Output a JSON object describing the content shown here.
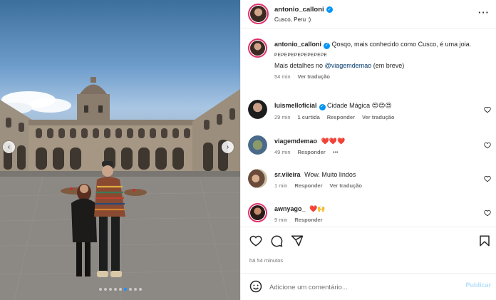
{
  "post": {
    "username": "antonio_calloni",
    "location": "Cusco, Peru :)",
    "more_icon": "more-horizontal-icon",
    "carousel": {
      "slide_count": 9,
      "active_slide": 6
    }
  },
  "caption": {
    "username": "antonio_calloni",
    "text": "Qosqo, mais conhecido como Cusco, é uma joia.",
    "caps_line": "PEPEPEPEPEPEPEPE",
    "details_prefix": "Mais detalhes no",
    "mention": "@viagemdemao",
    "details_suffix": "(em breve)",
    "time": "54 min",
    "translate": "Ver tradução"
  },
  "comments": [
    {
      "username": "luismelloficial",
      "verified": true,
      "text": "Cidade Mágica 😍😍😍",
      "time": "29 min",
      "likes": "1 curtida",
      "reply": "Responder",
      "translate": "Ver tradução"
    },
    {
      "username": "viagemdemao",
      "verified": false,
      "text": "❤️❤️❤️",
      "time": "49 min",
      "reply": "Responder",
      "more": "•••"
    },
    {
      "username": "sr.viieira",
      "verified": false,
      "text": "Wow. Muito lindos",
      "time": "1 min",
      "reply": "Responder",
      "translate": "Ver tradução"
    },
    {
      "username": "awnyago_",
      "verified": false,
      "text": "❤️🙌",
      "time": "9 min",
      "reply": "Responder"
    }
  ],
  "actions": {
    "like_icon": "heart-icon",
    "comment_icon": "comment-icon",
    "share_icon": "send-icon",
    "save_icon": "bookmark-icon",
    "timestamp": "há 54 minutos"
  },
  "composer": {
    "placeholder": "Adicione um comentário...",
    "post_label": "Publicar"
  },
  "colors": {
    "accent": "#0095f6",
    "ring": "#e1306c",
    "post_disabled": "#b2dffc"
  }
}
